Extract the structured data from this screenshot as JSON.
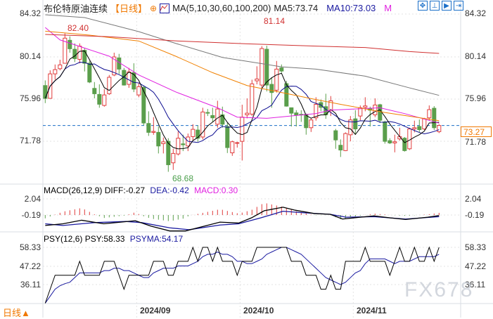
{
  "header": {
    "instrument": "布伦特原油连续",
    "period": "【日线】",
    "ma_params": "MA(5,10,30,60,100,200)",
    "ma5": "MA5:73.74",
    "ma10": "MA10:73.03",
    "ma_more": "M",
    "icons": [
      "crosshair-icon",
      "indicator-chart-icon"
    ]
  },
  "toolbar": {
    "icons": [
      "crosshair-move-icon",
      "zoom-range-icon",
      "play-icon",
      "jump-to-end-icon"
    ],
    "glyphs": [
      "✥",
      "⊥",
      "▶",
      "⇥"
    ]
  },
  "colors": {
    "up": "#e03c3c",
    "down": "#5a9e4b",
    "ma5": "#000000",
    "ma10": "#0a0a90",
    "ma30": "#e020e0",
    "ma60": "#f08000",
    "ma100": "#777777",
    "ma200": "#d03030",
    "diff": "#000000",
    "dea": "#1a1aa0",
    "psy": "#000000",
    "psyma": "#1a1aa0",
    "current_line": "#1b6fc8",
    "price_box": "#f07800"
  },
  "price_axis": {
    "ticks": [
      "84.32",
      "80.14",
      "75.96",
      "71.78"
    ]
  },
  "current_price": "73.27",
  "annotations": {
    "high": "82.40",
    "mid_high": "81.14",
    "low": "68.68"
  },
  "macd_panel": {
    "label": "MACD(26,12,9)",
    "diff": "DIFF:-0.27",
    "dea": "DEA:-0.42",
    "macd": "MACD:0.30",
    "ticks": [
      "2.04",
      "-0.19"
    ]
  },
  "psy_panel": {
    "label": "PSY(12,6)",
    "psy": "PSY:58.33",
    "psyma": "PSYMA:54.17",
    "ticks": [
      "58.33",
      "47.22",
      "36.11"
    ]
  },
  "x_axis": {
    "labels": [
      "2024/09",
      "2024/10",
      "2024/11"
    ],
    "label_at_candle": [
      20,
      41,
      64
    ]
  },
  "period_button": "日线▲",
  "watermark": "FX678",
  "chart_data": {
    "type": "candlestick",
    "x": "candle index 1-81 (daily)",
    "price_range": [
      68.0,
      84.32
    ],
    "candles_ohlc": [
      [
        77.23,
        77.74,
        75.49,
        75.96
      ],
      [
        75.96,
        78.74,
        75.96,
        78.39
      ],
      [
        78.39,
        79.32,
        77.81,
        78.81
      ],
      [
        78.9,
        79.79,
        78.74,
        79.28
      ],
      [
        79.44,
        82.4,
        79.44,
        81.93
      ],
      [
        81.72,
        82.11,
        80.49,
        80.88
      ],
      [
        80.83,
        81.41,
        79.56,
        79.9
      ],
      [
        79.83,
        81.41,
        79.44,
        81.14
      ],
      [
        80.72,
        80.95,
        78.63,
        79.44
      ],
      [
        79.44,
        79.67,
        77.47,
        77.58
      ],
      [
        76.95,
        77.58,
        75.96,
        76.42
      ],
      [
        76.35,
        77.35,
        75.03,
        75.38
      ],
      [
        75.26,
        76.88,
        75.14,
        76.3
      ],
      [
        76.42,
        78.28,
        76.3,
        78.05
      ],
      [
        78.28,
        80.49,
        78.16,
        80.07
      ],
      [
        79.97,
        80.37,
        78.39,
        78.86
      ],
      [
        78.74,
        78.98,
        77.23,
        77.28
      ],
      [
        77.35,
        78.98,
        77.0,
        78.58
      ],
      [
        78.51,
        79.44,
        76.58,
        76.88
      ],
      [
        76.3,
        77.47,
        76.07,
        77.12
      ],
      [
        77.05,
        77.23,
        73.28,
        73.52
      ],
      [
        73.47,
        74.68,
        72.24,
        72.59
      ],
      [
        72.59,
        74.1,
        72.35,
        72.68
      ],
      [
        72.59,
        73.17,
        70.5,
        71.24
      ],
      [
        71.47,
        72.08,
        70.5,
        71.65
      ],
      [
        71.7,
        72.01,
        68.68,
        69.38
      ],
      [
        69.57,
        70.96,
        68.87,
        70.5
      ],
      [
        70.45,
        72.7,
        70.3,
        72.01
      ],
      [
        71.45,
        72.36,
        70.73,
        71.36
      ],
      [
        71.24,
        72.47,
        70.73,
        72.13
      ],
      [
        72.17,
        73.4,
        71.77,
        72.89
      ],
      [
        72.82,
        73.28,
        71.66,
        72.01
      ],
      [
        72.13,
        75.03,
        71.89,
        74.61
      ],
      [
        74.56,
        74.91,
        74.21,
        74.49
      ],
      [
        74.26,
        75.03,
        73.63,
        74.03
      ],
      [
        73.4,
        75.72,
        73.05,
        74.91
      ],
      [
        74.33,
        75.14,
        73.05,
        73.4
      ],
      [
        73.17,
        73.52,
        70.54,
        71.08
      ],
      [
        70.56,
        71.77,
        70.26,
        71.66
      ],
      [
        71.5,
        71.66,
        71.08,
        71.57
      ],
      [
        71.7,
        75.33,
        69.8,
        74.1
      ],
      [
        74.33,
        75.96,
        73.98,
        74.49
      ],
      [
        74.4,
        77.81,
        74.21,
        77.4
      ],
      [
        77.7,
        79.14,
        77.35,
        77.88
      ],
      [
        77.28,
        81.14,
        77.0,
        80.9
      ],
      [
        80.83,
        81.18,
        76.65,
        77.28
      ],
      [
        77.35,
        78.05,
        75.03,
        76.54
      ],
      [
        76.77,
        79.67,
        76.54,
        78.86
      ],
      [
        78.98,
        79.32,
        78.51,
        78.67
      ],
      [
        77.42,
        77.7,
        75.14,
        75.19
      ],
      [
        75.03,
        75.03,
        73.17,
        74.49
      ],
      [
        74.52,
        74.79,
        73.17,
        74.31
      ],
      [
        74.38,
        74.79,
        73.63,
        74.31
      ],
      [
        74.38,
        74.45,
        72.36,
        73.05
      ],
      [
        73.05,
        73.98,
        72.63,
        73.82
      ],
      [
        74.03,
        76.07,
        73.75,
        75.37
      ],
      [
        75.54,
        75.84,
        74.68,
        75.07
      ],
      [
        75.14,
        76.42,
        73.93,
        74.33
      ],
      [
        74.79,
        76.19,
        74.21,
        75.72
      ],
      [
        72.75,
        72.93,
        70.96,
        71.84
      ],
      [
        71.31,
        71.89,
        70.15,
        70.84
      ],
      [
        70.78,
        72.59,
        70.73,
        72.47
      ],
      [
        72.35,
        74.21,
        71.7,
        73.82
      ],
      [
        73.93,
        74.79,
        72.36,
        72.93
      ],
      [
        74.21,
        75.26,
        73.79,
        75.03
      ],
      [
        75.07,
        76.07,
        74.68,
        75.21
      ],
      [
        74.96,
        75.14,
        73.17,
        74.79
      ],
      [
        74.33,
        75.96,
        74.1,
        75.3
      ],
      [
        75.33,
        75.42,
        73.52,
        73.79
      ],
      [
        73.63,
        73.75,
        71.47,
        71.7
      ],
      [
        71.77,
        72.01,
        71.43,
        71.54
      ],
      [
        71.54,
        72.36,
        70.61,
        71.66
      ],
      [
        71.94,
        73.05,
        71.77,
        72.17
      ],
      [
        72.01,
        72.13,
        70.68,
        70.78
      ],
      [
        70.96,
        73.05,
        70.84,
        72.93
      ],
      [
        72.93,
        73.75,
        72.59,
        73.05
      ],
      [
        73.17,
        73.86,
        72.59,
        72.86
      ],
      [
        72.93,
        74.03,
        72.82,
        73.93
      ],
      [
        74.03,
        75.26,
        73.75,
        74.84
      ],
      [
        74.98,
        75.19,
        72.82,
        73.05
      ],
      [
        72.66,
        73.4,
        72.52,
        73.27
      ]
    ],
    "ma_series": [
      {
        "name": "MA30",
        "points": [
          [
            1,
            82.99
          ],
          [
            4,
            81.76
          ],
          [
            14,
            80.14
          ],
          [
            20,
            78.28
          ],
          [
            27.5,
            76.6
          ],
          [
            36,
            75.03
          ],
          [
            40,
            74.1
          ],
          [
            46,
            73.98
          ],
          [
            56,
            74.45
          ],
          [
            59,
            74.79
          ],
          [
            69,
            75.03
          ],
          [
            74,
            74.45
          ],
          [
            81,
            73.5
          ]
        ]
      },
      {
        "name": "MA60",
        "points": [
          [
            1,
            82.62
          ],
          [
            10,
            82.23
          ],
          [
            20,
            81.65
          ],
          [
            27.5,
            80.14
          ],
          [
            35,
            78.51
          ],
          [
            42,
            77.23
          ],
          [
            49,
            76.54
          ],
          [
            56,
            75.84
          ],
          [
            61,
            75.37
          ],
          [
            70,
            74.56
          ],
          [
            81,
            73.75
          ]
        ]
      },
      {
        "name": "MA100",
        "points": [
          [
            1,
            84.25
          ],
          [
            9,
            83.97
          ],
          [
            20,
            82.58
          ],
          [
            27.5,
            81.41
          ],
          [
            37,
            80.02
          ],
          [
            49,
            79.09
          ],
          [
            56,
            78.86
          ],
          [
            66,
            78.16
          ],
          [
            75,
            77.0
          ],
          [
            81,
            76.26
          ]
        ]
      },
      {
        "name": "MA200",
        "points": [
          [
            1,
            82.3
          ],
          [
            14,
            82.07
          ],
          [
            28,
            81.65
          ],
          [
            42,
            81.37
          ],
          [
            56,
            81.14
          ],
          [
            66,
            81.0
          ],
          [
            75,
            80.6
          ],
          [
            81,
            80.42
          ]
        ]
      }
    ],
    "macd": {
      "range": [
        -2.5,
        2.04
      ],
      "diff_points": [
        [
          1,
          -1.63
        ],
        [
          4.6,
          -1.4
        ],
        [
          8.4,
          -0.91
        ],
        [
          12.9,
          -1.4
        ],
        [
          19.3,
          -0.98
        ],
        [
          22.5,
          -1.73
        ],
        [
          26.3,
          -2.39
        ],
        [
          29.5,
          -2.39
        ],
        [
          33.3,
          -1.73
        ],
        [
          36.5,
          -1.17
        ],
        [
          40.3,
          -1.3
        ],
        [
          42.9,
          -0.58
        ],
        [
          45.5,
          0.4
        ],
        [
          49.3,
          0.89
        ],
        [
          51.8,
          0.47
        ],
        [
          55.7,
          0.01
        ],
        [
          58.9,
          -0.09
        ],
        [
          61.4,
          -0.75
        ],
        [
          64.6,
          -0.52
        ],
        [
          67.8,
          -0.32
        ],
        [
          71,
          -0.58
        ],
        [
          74.2,
          -0.81
        ],
        [
          78.7,
          -0.49
        ],
        [
          81,
          -0.27
        ]
      ],
      "dea_points": [
        [
          1,
          -1.4
        ],
        [
          4.6,
          -1.63
        ],
        [
          11,
          -1.24
        ],
        [
          17.4,
          -1.08
        ],
        [
          20.6,
          -1.24
        ],
        [
          26.3,
          -1.96
        ],
        [
          30.2,
          -2.22
        ],
        [
          36.5,
          -1.57
        ],
        [
          40.3,
          -1.4
        ],
        [
          44.8,
          -0.58
        ],
        [
          49.3,
          0.33
        ],
        [
          53.1,
          0.14
        ],
        [
          58.9,
          -0.09
        ],
        [
          62.1,
          -0.49
        ],
        [
          67.8,
          -0.42
        ],
        [
          74.2,
          -0.75
        ],
        [
          81,
          -0.42
        ]
      ]
    },
    "psy": {
      "range": [
        25,
        58.33
      ],
      "values": [
        25,
        33.33,
        41.67,
        41.67,
        41.67,
        41.67,
        41.67,
        50,
        41.67,
        41.67,
        41.67,
        41.67,
        50,
        50,
        50,
        41.67,
        33.33,
        41.67,
        41.67,
        41.67,
        41.67,
        41.67,
        50,
        50,
        50,
        41.67,
        41.67,
        50,
        50,
        50,
        58.33,
        50,
        58.33,
        58.33,
        50,
        58.33,
        50,
        50,
        50,
        41.67,
        50,
        50,
        50,
        58.33,
        58.33,
        58.33,
        58.33,
        58.33,
        58.33,
        58.33,
        50,
        50,
        50,
        41.67,
        41.67,
        41.67,
        33.33,
        33.33,
        41.67,
        33.33,
        33.33,
        50,
        50,
        50,
        50,
        58.33,
        50,
        50,
        50,
        50,
        41.67,
        50,
        58.33,
        50,
        50,
        58.33,
        50,
        50,
        58.33,
        50,
        58.33
      ]
    }
  }
}
